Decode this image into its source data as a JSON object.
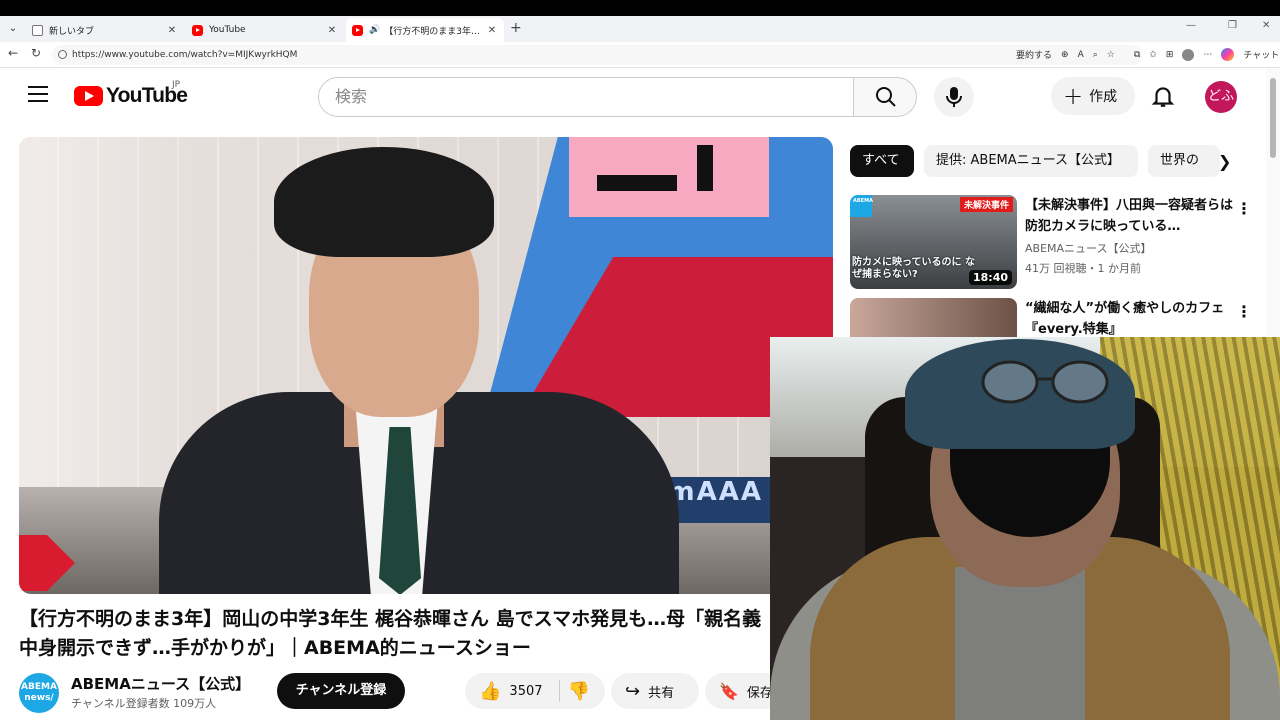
{
  "browser": {
    "tabs": [
      {
        "label": "新しいタブ",
        "active": false
      },
      {
        "label": "YouTube",
        "active": false
      },
      {
        "label": "【行方不明のまま3年】岡山の中学",
        "active": true
      }
    ],
    "url": "https://www.youtube.com/watch?v=MIJKwyrkHQM",
    "summarize_label": "要約する",
    "chat_label": "チャット"
  },
  "header": {
    "logo_text": "YouTube",
    "region": "JP",
    "search_placeholder": "検索",
    "create_label": "作成",
    "user_initials": "どふ"
  },
  "video": {
    "title": "【行方不明のまま3年】岡山の中学3年生 梶谷恭暉さん 島でスマホ発見も…母「親名義 中身開示できず…手がかりが」｜ABEMA的ニュースショー",
    "ticker_text": "hmAAA",
    "channel_name": "ABEMAニュース【公式】",
    "channel_avatar_text": "ABEMA news/",
    "subscribers": "チャンネル登録者数 109万人",
    "subscribe_label": "チャンネル登録",
    "likes": "3507",
    "share_label": "共有",
    "save_label": "保存"
  },
  "chips": [
    {
      "label": "すべて",
      "active": true
    },
    {
      "label": "提供: ABEMAニュース【公式】",
      "active": false
    },
    {
      "label": "世界の",
      "active": false
    }
  ],
  "recommendations": [
    {
      "title": "【未解決事件】八田與一容疑者らは防犯カメラに映っている…",
      "channel": "ABEMAニュース【公式】",
      "meta": "41万 回視聴・1 か月前",
      "duration": "18:40",
      "thumb_text": "防カメに映っているのに なぜ捕まらない?",
      "thumb_badge": "未解決事件"
    },
    {
      "title": "“繊細な人”が働く癒やしのカフェ『every.特集』",
      "channel": "",
      "meta": "",
      "duration": "",
      "thumb_text": "",
      "thumb_badge": ""
    }
  ],
  "colors": {
    "brand_red": "#ff0000",
    "avatar_bg": "#c2185b",
    "subscribe_bg": "#0f0f0f"
  }
}
